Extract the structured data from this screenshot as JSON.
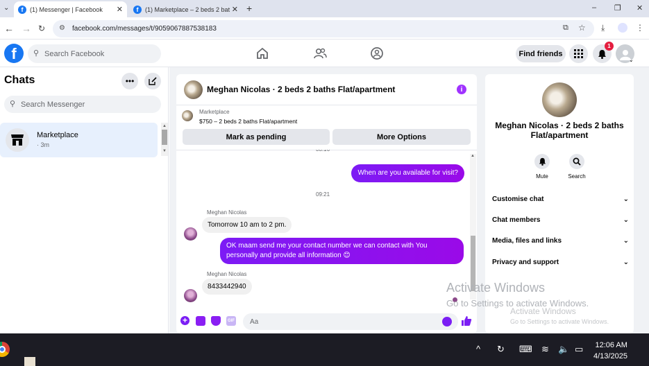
{
  "browser": {
    "tabs": [
      {
        "title": "(1) Messenger | Facebook",
        "active": true
      },
      {
        "title": "(1) Marketplace – 2 beds 2 bath",
        "active": false
      }
    ],
    "new_tab": "+",
    "url": "facebook.com/messages/t/9059067887538183",
    "window_controls": {
      "minimize": "–",
      "restore": "❐",
      "close": "✕"
    }
  },
  "header": {
    "logo": "f",
    "search_placeholder": "Search Facebook",
    "find_friends": "Find friends",
    "notification_count": "1"
  },
  "chats": {
    "title": "Chats",
    "search_placeholder": "Search Messenger",
    "items": [
      {
        "name": "Marketplace",
        "time": "· 3m"
      }
    ]
  },
  "conversation": {
    "title": "Meghan Nicolas · 2 beds 2 baths Flat/apartment",
    "marketplace_label": "Marketplace",
    "listing": "$750 – 2 beds 2 baths Flat/apartment",
    "mark_pending": "Mark as pending",
    "more_options": "More Options",
    "time_cut": "08:16",
    "msg_visit": "When are you available for visit?",
    "time_2": "09:21",
    "sender_1": "Meghan Nicolas",
    "msg_tomorrow": "Tomorrow 10 am to 2 pm.",
    "msg_ok_line1": "OK maam send me your contact number we can contact with You",
    "msg_ok_line2": "personally and provide all information 😊",
    "sender_2": "Meghan Nicolas",
    "msg_number": "8433442940",
    "composer_placeholder": "Aa"
  },
  "info_panel": {
    "name": "Meghan Nicolas · 2 beds 2 baths Flat/apartment",
    "mute": "Mute",
    "search": "Search",
    "sections": [
      "Customise chat",
      "Chat members",
      "Media, files and links",
      "Privacy and support"
    ]
  },
  "watermark": {
    "line1": "Activate Windows",
    "line2": "Go to Settings to activate Windows.",
    "line3": "Activate Windows",
    "line4": "Go to Settings to activate Windows."
  },
  "taskbar": {
    "time": "12:06 AM",
    "date": "4/13/2025"
  },
  "colors": {
    "brand": "#1877f2",
    "accent": "#8a0bf0",
    "badge": "#e41e3f"
  }
}
